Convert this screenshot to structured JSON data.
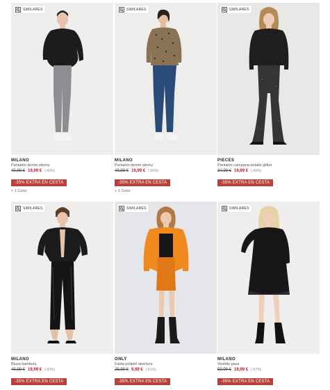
{
  "similar_label": "SIMILARES",
  "promo_label": "-35% EXTRA EN CESTA",
  "colors": {
    "price_red": "#c8102e",
    "promo_bg": "#b9413d"
  },
  "products": [
    {
      "brand": "MILANO",
      "name": "Pantalón denim skinny",
      "old_price": "49,99 €",
      "new_price": "19,99 €",
      "discount": "(-60%)",
      "color_count": "+ 1 Color"
    },
    {
      "brand": "MILANO",
      "name": "Pantalón denim skinny",
      "old_price": "49,99 €",
      "new_price": "19,99 €",
      "discount": "(-60%)",
      "color_count": "+ 1 Color"
    },
    {
      "brand": "PIECES",
      "name": "Pantalón campana detalle glitter",
      "old_price": "34,99 €",
      "new_price": "19,99 €",
      "discount": "(-43%)",
      "color_count": ""
    },
    {
      "brand": "MILANO",
      "name": "Blusa bambula",
      "old_price": "49,99 €",
      "new_price": "19,99 €",
      "discount": "(-60%)",
      "color_count": ""
    },
    {
      "brand": "ONLY",
      "name": "Falda polipiel abertura",
      "old_price": "25,99 €",
      "new_price": "9,99 €",
      "discount": "(-61%)",
      "color_count": ""
    },
    {
      "brand": "MILANO",
      "name": "Vestido gasa",
      "old_price": "59,99 €",
      "new_price": "19,99 €",
      "discount": "(-67%)",
      "color_count": ""
    }
  ]
}
